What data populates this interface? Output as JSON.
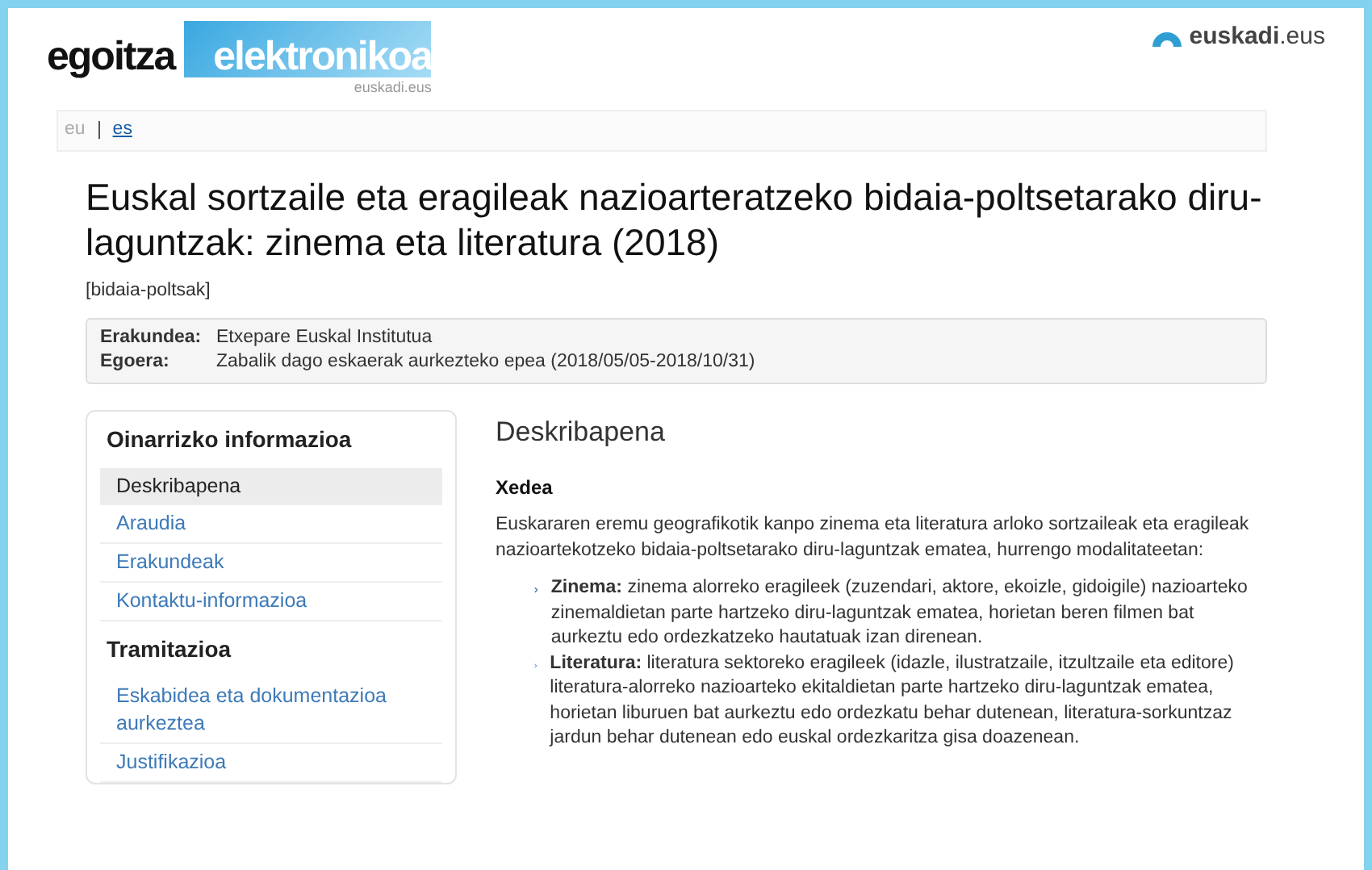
{
  "header": {
    "logo": {
      "word_1": "egoitza",
      "word_2": "elektronikoa",
      "subtitle": "euskadi.eus"
    },
    "brand": "**euskadi**.eus"
  },
  "languages": [
    {
      "label": "eu",
      "selected": true
    },
    {
      "label": "es",
      "selected": false
    }
  ],
  "title": "Euskal sortzaile eta eragileak nazioarteratzeko bidaia-poltsetarako diru-laguntzak: zinema eta literatura (2018)",
  "tag": "[bidaia-poltsak]",
  "summary": [
    {
      "label": "Erakundea:",
      "value": "Etxepare Euskal Institutua"
    },
    {
      "label": "Egoera:",
      "value": "Zabalik dago eskaerak aurkezteko epea (2018/05/05-2018/10/31)"
    }
  ],
  "sidebar": {
    "sections": [
      {
        "title": "Oinarrizko informazioa",
        "items": [
          {
            "label": "Deskribapena",
            "selected": true
          },
          {
            "label": "Araudia",
            "selected": false
          },
          {
            "label": "Erakundeak",
            "selected": false
          },
          {
            "label": "Kontaktu-informazioa",
            "selected": false
          }
        ]
      },
      {
        "title": "Tramitazioa",
        "items": [
          {
            "label": "Eskabidea eta dokumentazioa aurkeztea",
            "selected": false
          },
          {
            "label": "Justifikazioa",
            "selected": false
          }
        ]
      }
    ]
  },
  "content": {
    "heading": "Deskribapena",
    "subheading": "Xedea",
    "intro": "Euskararen eremu geografikotik kanpo zinema eta literatura arloko sortzaileak eta eragileak nazioartekotzeko bidaia-poltsetarako diru-laguntzak ematea, hurrengo modalitateetan:",
    "items": [
      {
        "text": "**Zinema:** zinema alorreko eragileek (zuzendari, aktore, ekoizle, gidoigile) nazioarteko zinemaldietan parte hartzeko diru-laguntzak ematea, horietan beren filmen bat aurkeztu edo ordezkatzeko hautatuak izan direnean."
      },
      {
        "text": "**Literatura:** literatura sektoreko eragileek (idazle, ilustratzaile, itzultzaile eta editore) literatura-alorreko nazioarteko ekitaldietan parte hartzeko diru-laguntzak ematea, horietan liburuen bat aurkeztu edo ordezkatu behar dutenean, literatura-sorkuntzaz jardun behar dutenean edo euskal ordezkaritza gisa doazenean."
      }
    ]
  }
}
